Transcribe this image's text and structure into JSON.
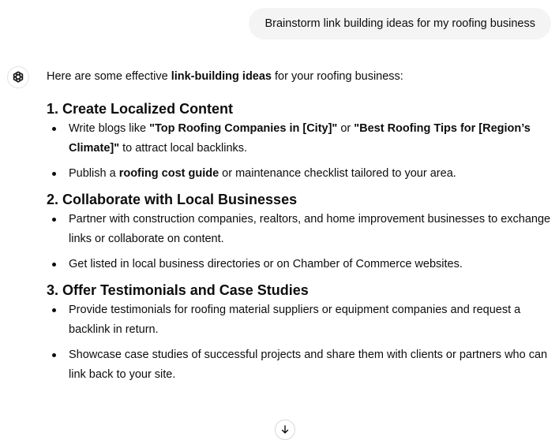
{
  "user_message": "Brainstorm link building ideas for my roofing business",
  "assistant": {
    "avatar_icon": "openai-logo-icon",
    "intro": {
      "before": "Here are some effective ",
      "bold": "link-building ideas",
      "after": " for your roofing business:"
    },
    "sections": [
      {
        "title": "1. Create Localized Content",
        "bullets": [
          {
            "p1": "Write blogs like ",
            "b1": "\"Top Roofing Companies in [City]\"",
            "p2": " or ",
            "b2": "\"Best Roofing Tips for [Region’s Climate]\"",
            "p3": " to attract local backlinks."
          },
          {
            "p1": "Publish a ",
            "b1": "roofing cost guide",
            "p2": " or maintenance checklist tailored to your area."
          }
        ]
      },
      {
        "title": "2. Collaborate with Local Businesses",
        "bullets": [
          "Partner with construction companies, realtors, and home improvement businesses to exchange links or collaborate on content.",
          "Get listed in local business directories or on Chamber of Commerce websites."
        ]
      },
      {
        "title": "3. Offer Testimonials and Case Studies",
        "bullets": [
          "Provide testimonials for roofing material suppliers or equipment companies and request a backlink in return.",
          "Showcase case studies of successful projects and share them with clients or partners who can link back to your site."
        ]
      }
    ]
  },
  "scroll_button_icon": "arrow-down-icon"
}
